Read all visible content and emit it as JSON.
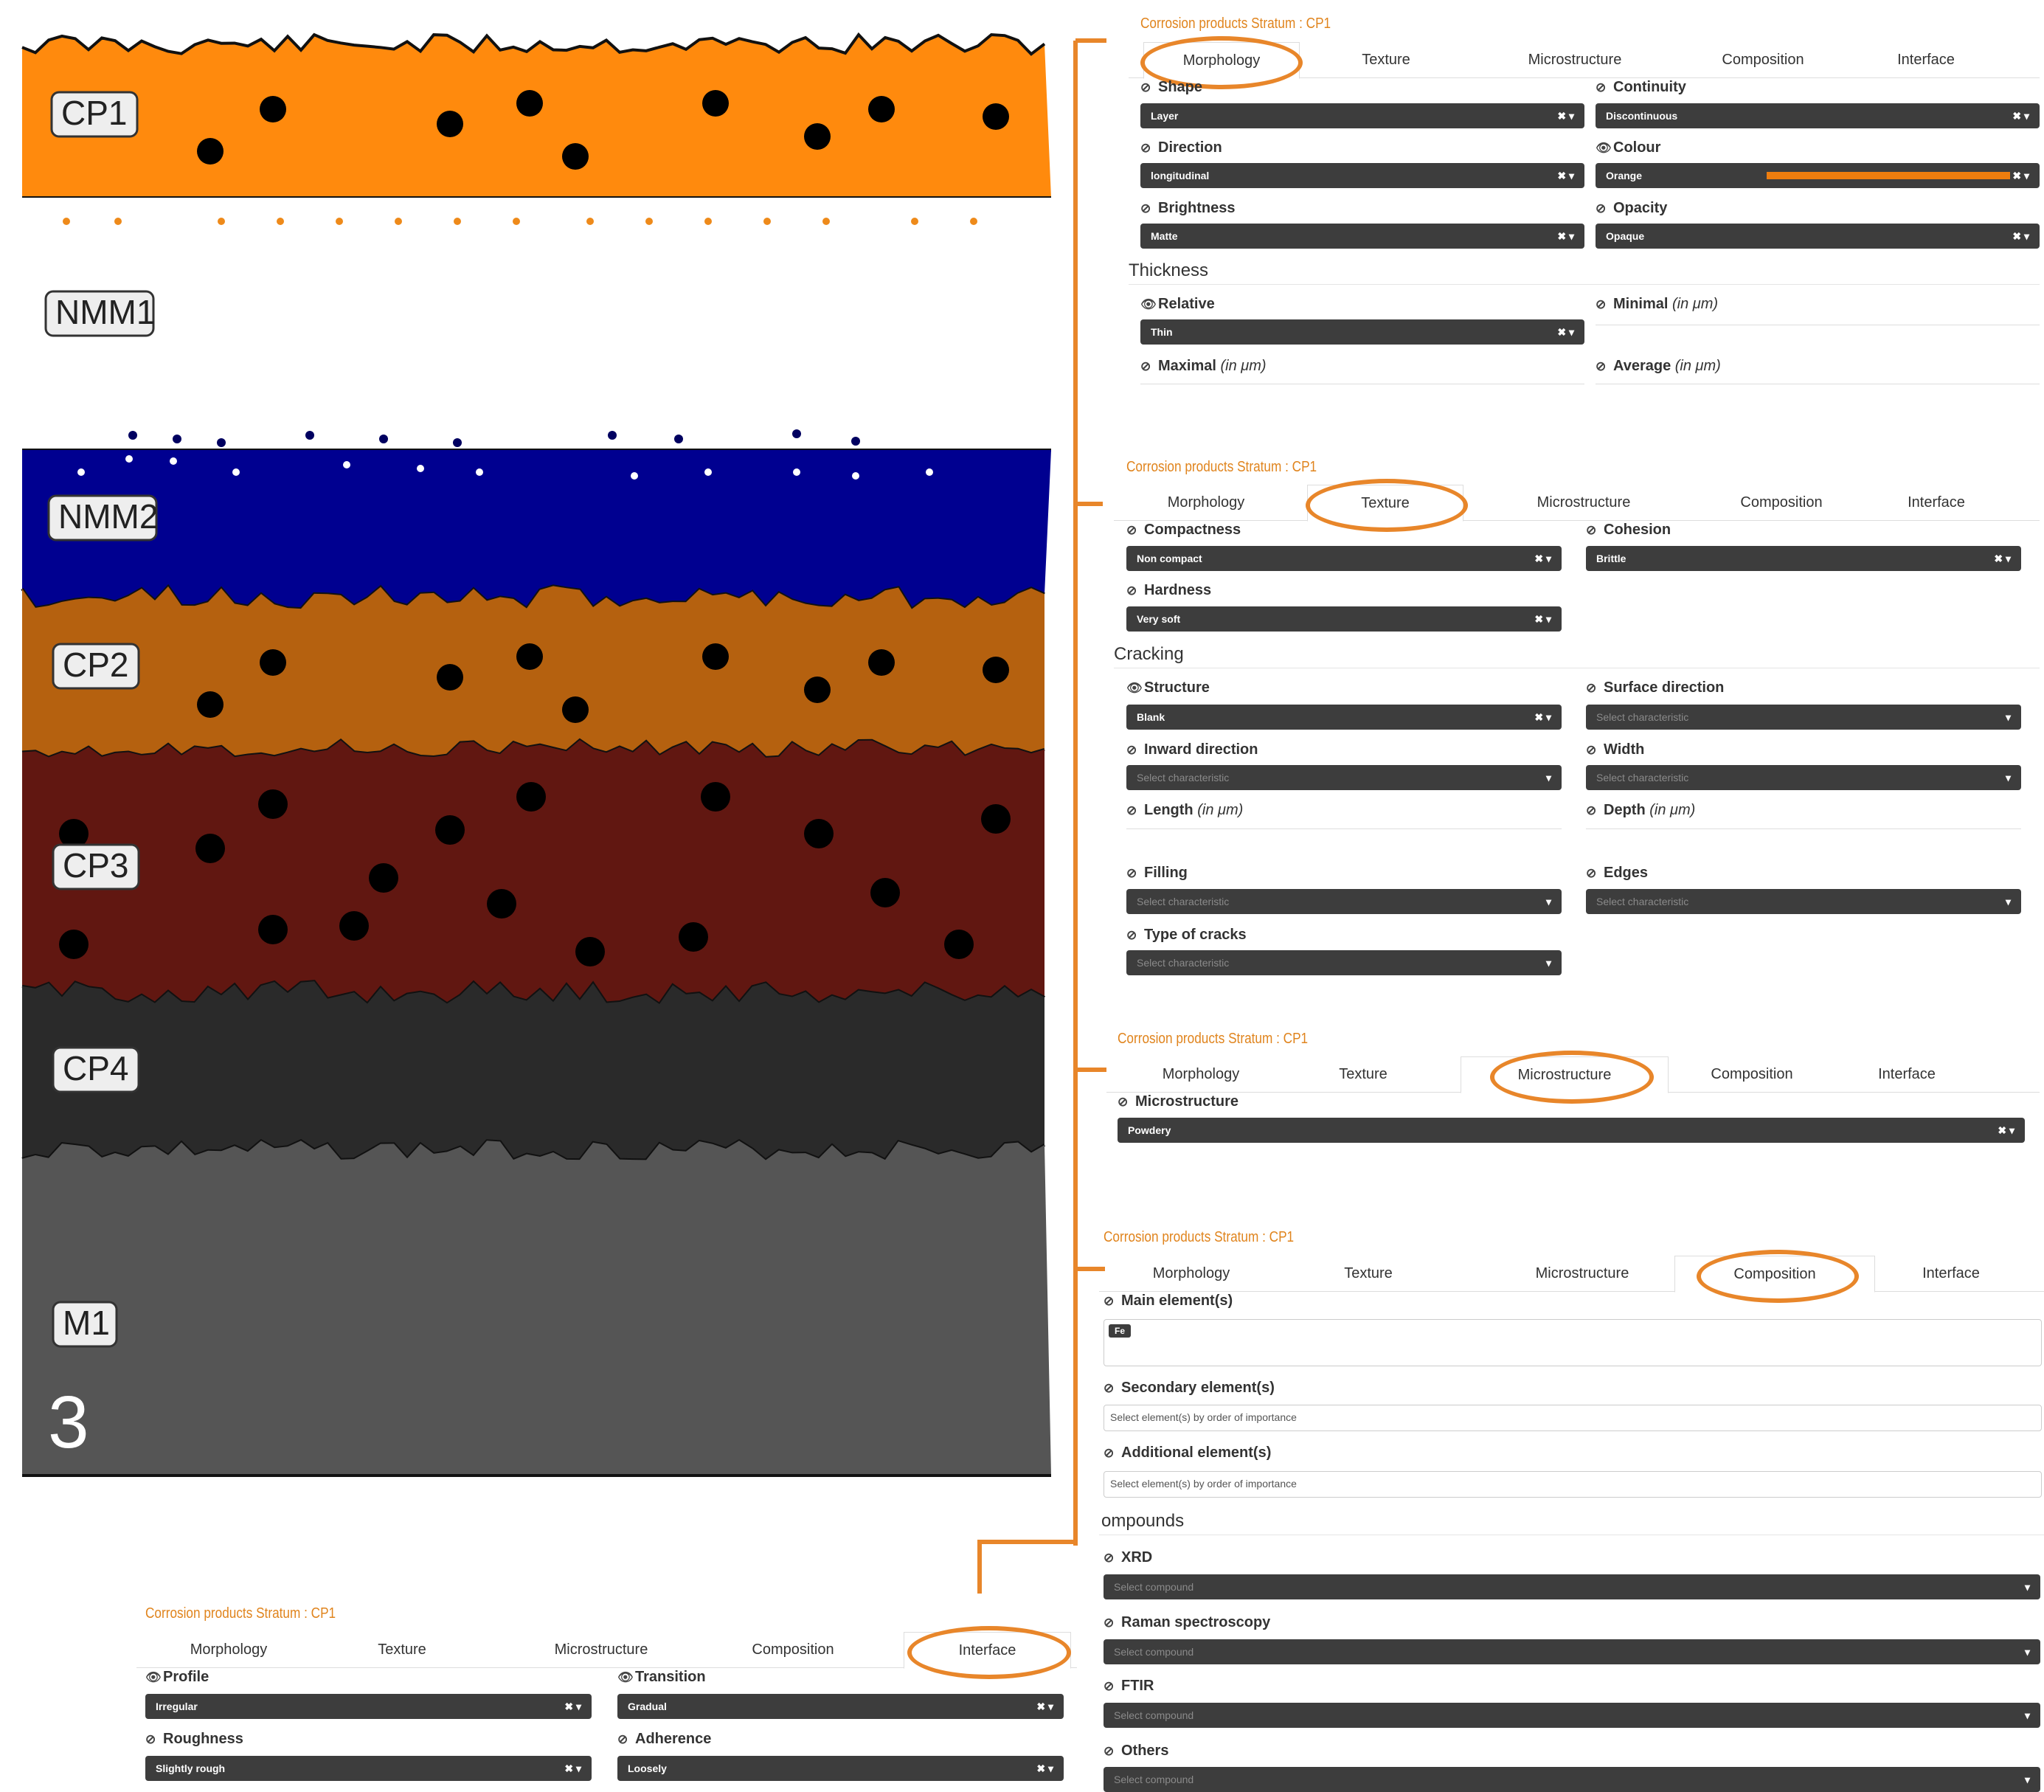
{
  "figure_number": "3",
  "layers": [
    {
      "label": "CP1",
      "color": "#ff8a0d"
    },
    {
      "label": "NMM1",
      "color": "#ffffff"
    },
    {
      "label": "NMM2",
      "color": "#000090"
    },
    {
      "label": "CP2",
      "color": "#b5610f"
    },
    {
      "label": "CP3",
      "color": "#611711"
    },
    {
      "label": "CP4",
      "color": "#2a2a2a"
    },
    {
      "label": "M1",
      "color": "#555555"
    }
  ],
  "colors": {
    "accent": "#e0841d",
    "field_bg": "#3d3d3d",
    "colour_swatch": "#ee7d0e"
  },
  "icons": {
    "eye": "eye-icon",
    "eye_slash": "eye-slash-icon",
    "clear": "clear-x-icon",
    "caret": "caret-down-icon"
  },
  "tabs": [
    "Morphology",
    "Texture",
    "Microstructure",
    "Composition",
    "Interface"
  ],
  "morphology": {
    "title": "Corrosion products Stratum : CP1",
    "active_tab": "Morphology",
    "shape": {
      "label": "Shape",
      "value": "Layer"
    },
    "continuity": {
      "label": "Continuity",
      "value": "Discontinuous"
    },
    "direction": {
      "label": "Direction",
      "value": "longitudinal"
    },
    "colour": {
      "label": "Colour",
      "value": "Orange"
    },
    "brightness": {
      "label": "Brightness",
      "value": "Matte"
    },
    "opacity": {
      "label": "Opacity",
      "value": "Opaque"
    },
    "thickness_heading": "Thickness",
    "relative": {
      "label": "Relative",
      "value": "Thin"
    },
    "minimal": {
      "label": "Minimal",
      "unit": "(in μm)"
    },
    "maximal": {
      "label": "Maximal",
      "unit": "(in μm)"
    },
    "average": {
      "label": "Average",
      "unit": "(in μm)"
    }
  },
  "texture": {
    "title": "Corrosion products Stratum : CP1",
    "active_tab": "Texture",
    "compactness": {
      "label": "Compactness",
      "value": "Non compact"
    },
    "cohesion": {
      "label": "Cohesion",
      "value": "Brittle"
    },
    "hardness": {
      "label": "Hardness",
      "value": "Very soft"
    },
    "cracking_heading": "Cracking",
    "structure": {
      "label": "Structure",
      "value": "Blank"
    },
    "surface_direction": {
      "label": "Surface direction",
      "placeholder": "Select characteristic"
    },
    "inward_direction": {
      "label": "Inward direction",
      "placeholder": "Select characteristic"
    },
    "width": {
      "label": "Width",
      "placeholder": "Select characteristic"
    },
    "length": {
      "label": "Length",
      "unit": "(in μm)"
    },
    "depth": {
      "label": "Depth",
      "unit": "(in μm)"
    },
    "filling": {
      "label": "Filling",
      "placeholder": "Select characteristic"
    },
    "edges": {
      "label": "Edges",
      "placeholder": "Select characteristic"
    },
    "type_of_cracks": {
      "label": "Type of cracks",
      "placeholder": "Select characteristic"
    }
  },
  "microstructure": {
    "title": "Corrosion products Stratum : CP1",
    "active_tab": "Microstructure",
    "microstructure": {
      "label": "Microstructure",
      "value": "Powdery"
    }
  },
  "composition": {
    "title": "Corrosion products Stratum : CP1",
    "active_tab": "Composition",
    "main_elements": {
      "label": "Main element(s)",
      "tag": "Fe"
    },
    "secondary_elements": {
      "label": "Secondary element(s)",
      "placeholder": "Select element(s) by order of importance"
    },
    "additional_elements": {
      "label": "Additional element(s)",
      "placeholder": "Select element(s) by order of importance"
    },
    "compounds_heading": "ompounds",
    "xrd": {
      "label": "XRD",
      "placeholder": "Select compound"
    },
    "raman": {
      "label": "Raman spectroscopy",
      "placeholder": "Select compound"
    },
    "ftir": {
      "label": "FTIR",
      "placeholder": "Select compound"
    },
    "others": {
      "label": "Others",
      "placeholder": "Select compound"
    }
  },
  "interface": {
    "title": "Corrosion products Stratum : CP1",
    "active_tab": "Interface",
    "profile": {
      "label": "Profile",
      "value": "Irregular"
    },
    "transition": {
      "label": "Transition",
      "value": "Gradual"
    },
    "roughness": {
      "label": "Roughness",
      "value": "Slightly rough"
    },
    "adherence": {
      "label": "Adherence",
      "value": "Loosely"
    }
  }
}
